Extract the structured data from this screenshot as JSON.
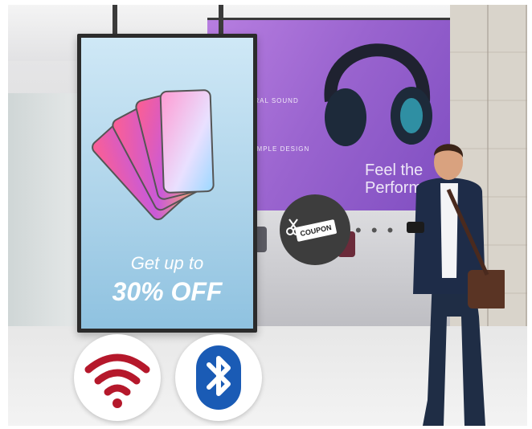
{
  "signage": {
    "promo_line1": "Get up to",
    "promo_line2": "30% OFF"
  },
  "videowall": {
    "text_small_1": "ERAL SOUND",
    "text_small_2": "SIMPLE DESIGN",
    "text_big_1": "Feel the",
    "text_big_2": "Perform"
  },
  "coupon": {
    "label": "COUPON"
  },
  "connectivity_icons": [
    "wifi-icon",
    "bluetooth-icon"
  ],
  "colors": {
    "wifi": "#b5182b",
    "bluetooth": "#1a5bb5",
    "display_frame": "#2b2b2b",
    "videowall": "#9a64cf"
  }
}
